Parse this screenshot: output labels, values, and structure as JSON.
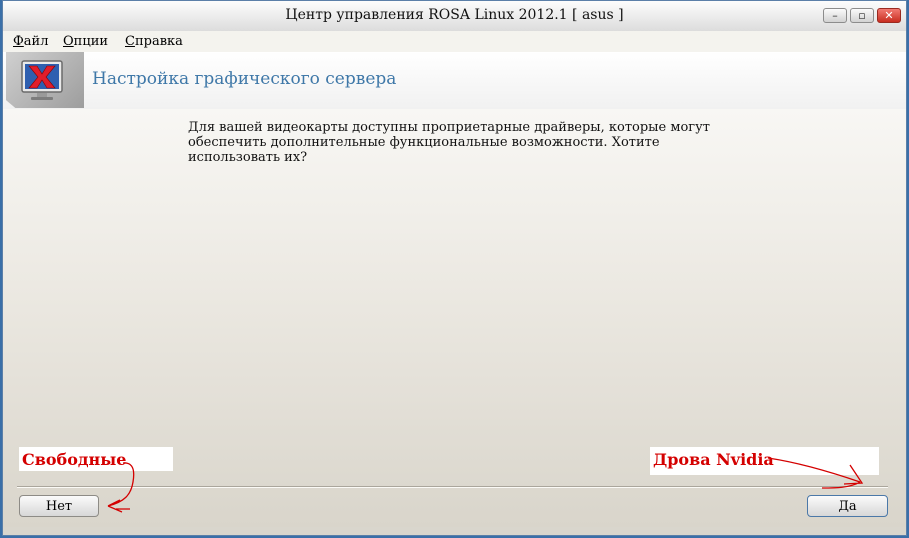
{
  "window": {
    "title": "Центр управления ROSA Linux 2012.1 [ asus ]",
    "buttons": {
      "minimize": "–",
      "maximize": "▫",
      "close": "✕"
    }
  },
  "menu": {
    "items": [
      {
        "label": "Файл"
      },
      {
        "label": "Опции"
      },
      {
        "label": "Справка"
      }
    ]
  },
  "header": {
    "title": "Настройка графического сервера",
    "icon": "xserver-icon"
  },
  "message": {
    "lines": [
      "Для вашей видеокарты доступны проприетарные драйверы, которые могут",
      "обеспечить дополнительные функциональные возможности. Хотите",
      "использовать их?"
    ]
  },
  "buttons": {
    "no": "Нет",
    "yes": "Да"
  },
  "annotations": {
    "left": "Свободные",
    "right": "Дрова Nvidia",
    "color": "#d40000"
  },
  "colors": {
    "header_title": "#3f78a8",
    "close_button": "#c82d20"
  }
}
